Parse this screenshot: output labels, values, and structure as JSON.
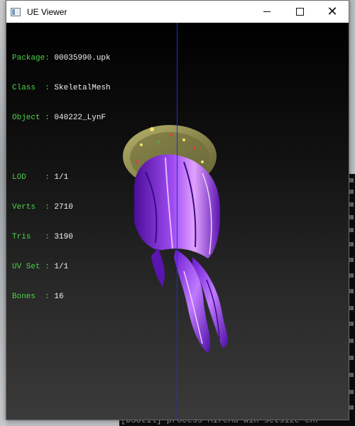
{
  "window": {
    "title": "UE Viewer",
    "icon": "app-window-icon",
    "controls": {
      "minimize": "minimize-icon",
      "maximize": "maximize-icon",
      "close": "✕"
    }
  },
  "info": {
    "package_label": "Package:",
    "package": "00035990.upk",
    "class_label": "Class  :",
    "class": "SkeletalMesh",
    "object_label": "Object :",
    "object": "040222_LynF",
    "lod_label": "LOD    :",
    "lod": "1/1",
    "verts_label": "Verts  :",
    "verts": "2710",
    "tris_label": "Tris   :",
    "tris": "3190",
    "uvset_label": "UV Set :",
    "uvset": "1/1",
    "bones_label": "Bones  :",
    "bones": "16"
  },
  "background": {
    "console_fragment": "[DSUtil] process  MireMu win setsize  chr"
  },
  "colors": {
    "label_green": "#4ad24a",
    "value_white": "#f2f2f2",
    "axis_blue": "#1d2fd6",
    "hair_purple": "#8a2be2",
    "hat_olive": "#8c8a48"
  }
}
